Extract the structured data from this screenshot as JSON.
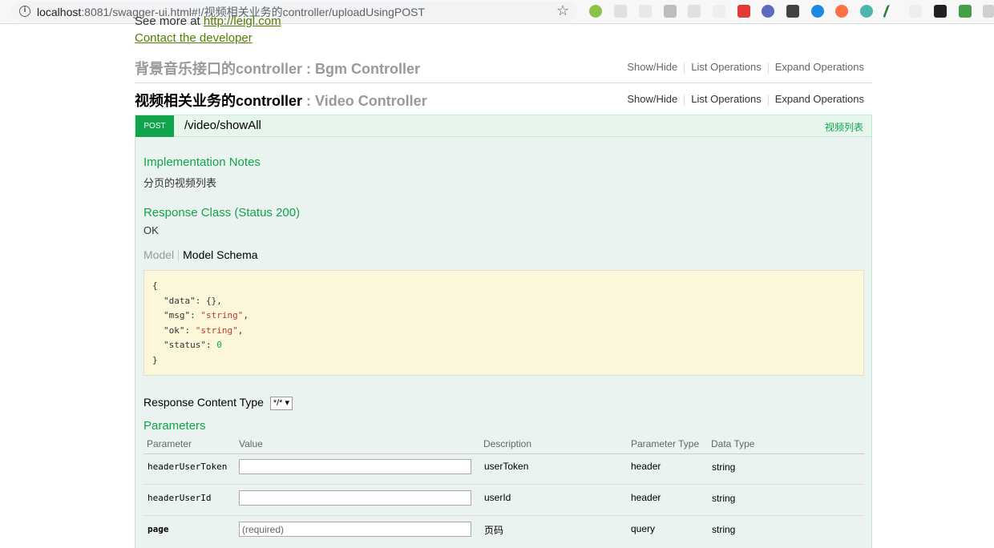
{
  "browser": {
    "url_host": "localhost",
    "url_rest": ":8081/swagger-ui.html#!/视频相关业务的controller/uploadUsingPOST"
  },
  "info": {
    "see_more_prefix": "See more at ",
    "see_more_link": "http://leigl.com",
    "contact_link": "Contact the developer"
  },
  "resources": [
    {
      "name_cn": "背景音乐接口的controller",
      "colon_name": " : Bgm Controller",
      "ops": [
        "Show/Hide",
        "List Operations",
        "Expand Operations"
      ]
    },
    {
      "name_cn": "视频相关业务的controller",
      "colon_name": " : Video Controller",
      "ops": [
        "Show/Hide",
        "List Operations",
        "Expand Operations"
      ]
    }
  ],
  "operation": {
    "method": "POST",
    "path": "/video/showAll",
    "summary": "视频列表",
    "impl_notes_title": "Implementation Notes",
    "impl_notes": "分页的视频列表",
    "response_class_title": "Response Class (Status 200)",
    "response_class": "OK",
    "model_tab": "Model",
    "model_schema_tab": "Model Schema",
    "schema_lines": {
      "open": "{",
      "data_key": "\"data\": {},",
      "msg_key": "\"msg\": ",
      "msg_val": "\"string\"",
      "ok_key": "\"ok\": ",
      "ok_val": "\"string\"",
      "status_key": "\"status\": ",
      "status_val": "0",
      "close": "}"
    },
    "response_content_type_label": "Response Content Type",
    "response_content_type_value": "*/*",
    "parameters_title": "Parameters",
    "param_headers": [
      "Parameter",
      "Value",
      "Description",
      "Parameter Type",
      "Data Type"
    ],
    "params": [
      {
        "name": "headerUserToken",
        "value": "",
        "placeholder": "",
        "description": "userToken",
        "param_type": "header",
        "data_type": "string"
      },
      {
        "name": "headerUserId",
        "value": "",
        "placeholder": "",
        "description": "userId",
        "param_type": "header",
        "data_type": "string"
      },
      {
        "name": "page",
        "value": "",
        "placeholder": "(required)",
        "description": "页码",
        "param_type": "query",
        "data_type": "string"
      }
    ]
  }
}
